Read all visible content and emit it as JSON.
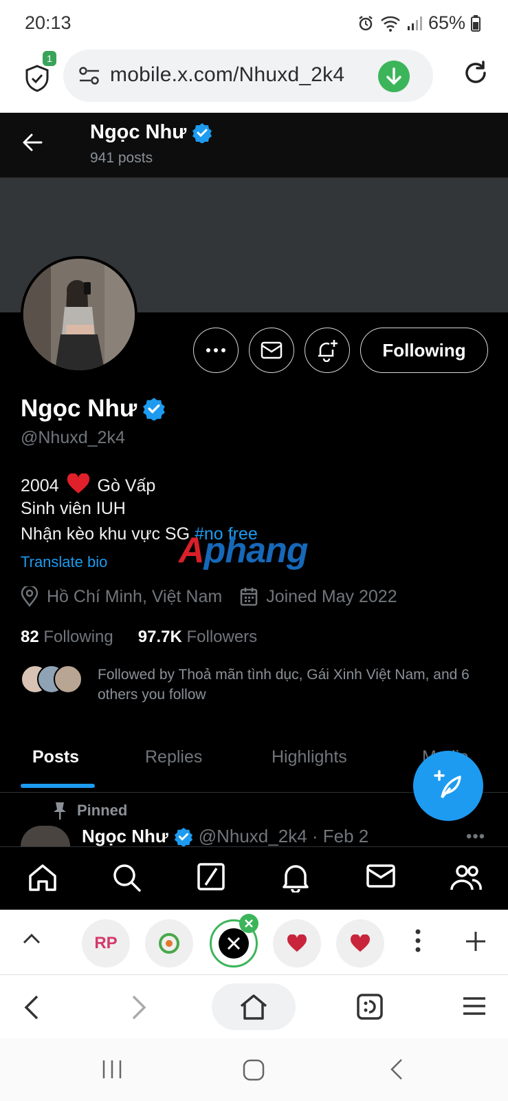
{
  "status_bar": {
    "time": "20:13",
    "battery": "65%"
  },
  "browser": {
    "shield_badge": "1",
    "url": "mobile.x.com/Nhuxd_2k4",
    "tab_chip_rp": "RP"
  },
  "header": {
    "name": "Ngọc Như",
    "post_count": "941 posts"
  },
  "profile": {
    "following_button": "Following",
    "name": "Ngọc Như",
    "handle": "@Nhuxd_2k4",
    "bio_line1_a": "2004",
    "bio_line1_b": "Gò Vấp",
    "bio_line2": "Sinh viên IUH",
    "bio_line3": "Nhận kèo khu vực SG",
    "bio_hashtag": "#no free",
    "translate_bio": "Translate bio",
    "location": "Hồ Chí Minh, Việt Nam",
    "joined": "Joined May 2022",
    "following_count": "82",
    "following_label": "Following",
    "followers_count": "97.7K",
    "followers_label": "Followers",
    "followed_by": "Followed by Thoả mãn tình dục, Gái Xinh Việt Nam, and 6 others you follow"
  },
  "watermark": {
    "first": "A",
    "rest": "phang"
  },
  "tabs": [
    "Posts",
    "Replies",
    "Highlights",
    "Media"
  ],
  "pinned": {
    "label": "Pinned",
    "author": "Ngọc Như",
    "meta": "@Nhuxd_2k4 · Feb 2"
  },
  "colors": {
    "accent": "#1d9bf0",
    "background": "#000000",
    "muted": "#71767b",
    "download": "#3cb55a"
  }
}
